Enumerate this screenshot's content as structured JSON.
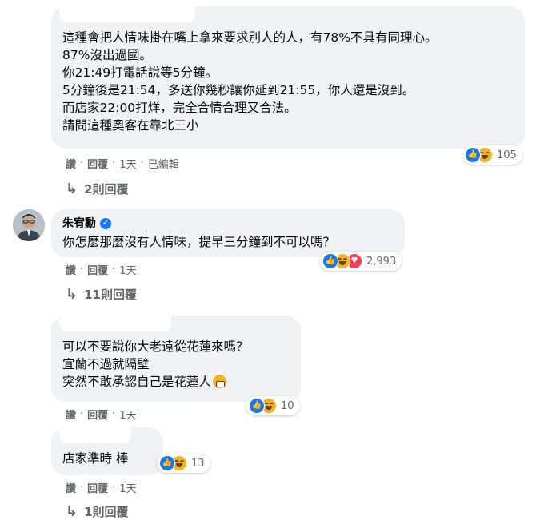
{
  "comments": [
    {
      "text": "這種會把人情味掛在嘴上拿來要求別人的人，有78%不具有同理心。\n87%沒出過國。\n你21:49打電話說等5分鐘。\n5分鐘後是21:54，多送你幾秒讓你延到21:55，你人還是沒到。\n而店家22:00打烊，完全合情合理又合法。\n請問這種奧客在靠北三小",
      "reaction_count": "105",
      "actions": {
        "like": "讚",
        "reply": "回覆",
        "time": "1天",
        "edited": "已編輯"
      },
      "replies_label": "2則回覆"
    },
    {
      "author": "朱宥勳",
      "text": "你怎麼那麼沒有人情味，提早三分鐘到不可以嗎？",
      "reaction_count": "2,993",
      "actions": {
        "like": "讚",
        "reply": "回覆",
        "time": "1天"
      },
      "replies_label": "11則回覆"
    },
    {
      "text_lines": [
        "可以不要說你大老遠從花蓮來嗎？",
        "宜蘭不過就隔壁",
        "突然不敢承認自己是花蓮人"
      ],
      "reaction_count": "10",
      "actions": {
        "like": "讚",
        "reply": "回覆",
        "time": "1天"
      }
    },
    {
      "text": "店家準時 棒",
      "reaction_count": "13",
      "actions": {
        "like": "讚",
        "reply": "回覆",
        "time": "1天"
      },
      "replies_label": "1則回覆"
    }
  ],
  "icons": {
    "like": "like-reaction-icon",
    "haha": "haha-reaction-icon",
    "love": "love-reaction-icon",
    "reply_arrow": "reply-arrow-icon",
    "verified": "verified-badge-icon"
  },
  "colors": {
    "bubble": "#f0f2f5",
    "secondary_text": "#65676b",
    "like_blue": "#1877f2",
    "haha_yellow": "#f7b125",
    "love_red": "#f33e58"
  }
}
